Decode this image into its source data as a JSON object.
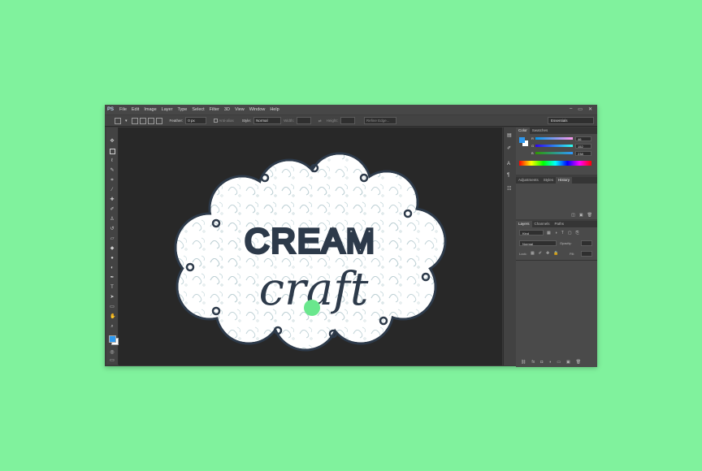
{
  "app": {
    "logo": "PS"
  },
  "menu": [
    "File",
    "Edit",
    "Image",
    "Layer",
    "Type",
    "Select",
    "Filter",
    "3D",
    "View",
    "Window",
    "Help"
  ],
  "window_controls": [
    "–",
    "▭",
    "✕"
  ],
  "options": {
    "feather_label": "Feather:",
    "feather_value": "0 px",
    "antialias_label": "Anti-alias",
    "style_label": "Style:",
    "style_value": "Normal",
    "width_label": "Width:",
    "height_label": "Height:",
    "refine_edge": "Refine Edge...",
    "workspace": "Essentials"
  },
  "color_panel": {
    "tabs": [
      "Color",
      "Swatches"
    ],
    "r_label": "R",
    "g_label": "G",
    "b_label": "B",
    "r": "46",
    "g": "152",
    "b": "238",
    "foreground": "#2e98ee",
    "background": "#ffffff"
  },
  "adjust_panel": {
    "tabs": [
      "Adjustments",
      "Styles",
      "History"
    ]
  },
  "layers_panel": {
    "tabs": [
      "Layers",
      "Channels",
      "Paths"
    ],
    "kind": "Kind",
    "blend_mode": "Normal",
    "opacity_label": "Opacity:",
    "lock_label": "Lock:",
    "fill_label": "Fill:"
  },
  "artwork": {
    "line1": "CREAM",
    "line2": "craft",
    "ink_color": "#2d3a4a",
    "dot_color": "#6ae78d"
  }
}
